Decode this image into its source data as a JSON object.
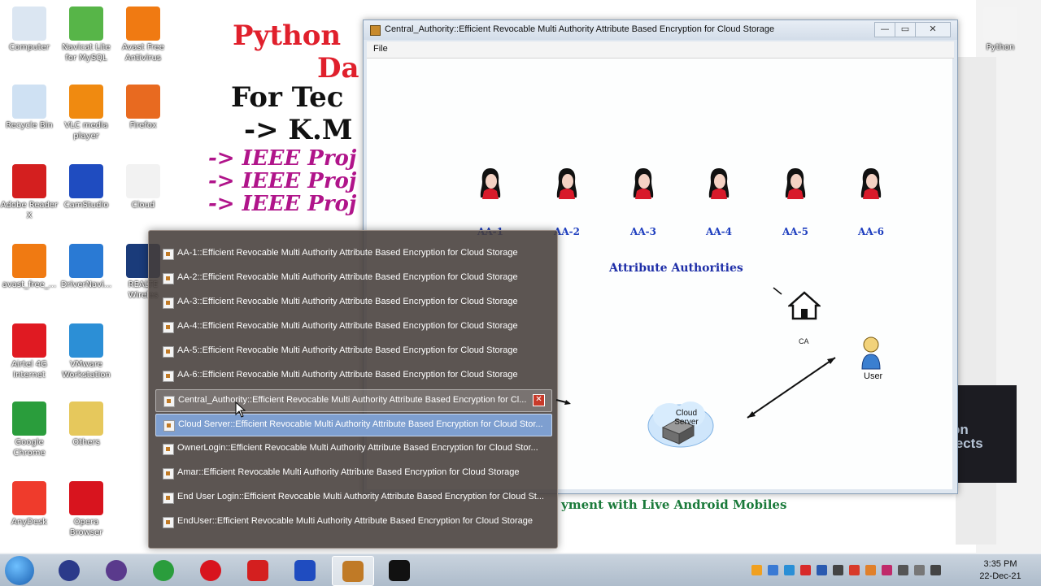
{
  "background_slide": {
    "title_line1": "Python",
    "title_line2": "Da",
    "title_line3": "For Tec",
    "title_line4": "-> K.M",
    "ieee_lines": [
      "-> IEEE Proj",
      "-> IEEE Proj",
      "-> IEEE Proj"
    ],
    "bottom_text": "yment with Live Android Mobiles",
    "dark_panel_text": "on\njects"
  },
  "desktop_icons": [
    {
      "label": "Computer",
      "icon": "computer-icon",
      "color": "#dbe6f2"
    },
    {
      "label": "Navicat Lite for MySQL",
      "icon": "navicat-icon",
      "color": "#57b548"
    },
    {
      "label": "Avast Free Antivirus",
      "icon": "avast-icon",
      "color": "#f07a12"
    },
    {
      "label": "Recycle Bin",
      "icon": "recycle-bin-icon",
      "color": "#cfe1f3"
    },
    {
      "label": "VLC media player",
      "icon": "vlc-icon",
      "color": "#f08a10"
    },
    {
      "label": "Firefox",
      "icon": "firefox-icon",
      "color": "#e86a20"
    },
    {
      "label": "Adobe Reader X",
      "icon": "adobe-reader-icon",
      "color": "#d41f1f"
    },
    {
      "label": "CamStudio",
      "icon": "camstudio-icon",
      "color": "#1f4cc0"
    },
    {
      "label": "Cloud",
      "icon": "cloud-folder-icon",
      "color": "#f2f2f2"
    },
    {
      "label": "avast_free_...",
      "icon": "avast-installer-icon",
      "color": "#f07a12"
    },
    {
      "label": "DriverNavi...",
      "icon": "drivernavigator-icon",
      "color": "#2a7ad4"
    },
    {
      "label": "REALTE Wireles",
      "icon": "realtek-icon",
      "color": "#1a3b7a"
    },
    {
      "label": "Airtel 4G Internet",
      "icon": "airtel-icon",
      "color": "#e01a22"
    },
    {
      "label": "VMware Workstation",
      "icon": "vmware-icon",
      "color": "#2c8fd6"
    },
    {
      "label": "Google Chrome",
      "icon": "chrome-icon",
      "color": "#2a9d3c"
    },
    {
      "label": "Others",
      "icon": "folder-icon",
      "color": "#e6c85c"
    },
    {
      "label": "AnyDesk",
      "icon": "anydesk-icon",
      "color": "#ef3b2c"
    },
    {
      "label": "Opera Browser",
      "icon": "opera-icon",
      "color": "#d8141e"
    },
    {
      "label": "Python",
      "icon": "python-file-icon",
      "color": "#f4f4f4"
    }
  ],
  "window": {
    "title": "Central_Authority::Efficient Revocable Multi Authority Attribute Based Encryption for Cloud Storage",
    "menu_file": "File",
    "btn_min": "—",
    "btn_max": "▭",
    "btn_close": "✕"
  },
  "diagram": {
    "authorities": [
      "AA-1",
      "AA-2",
      "AA-3",
      "AA-4",
      "AA-5",
      "AA-6"
    ],
    "group_label": "Attribute Authorities",
    "ca_label": "CA",
    "user_label": "User",
    "cloud_label": "Cloud Server"
  },
  "jump_list": {
    "items": [
      "AA-1::Efficient Revocable Multi Authority Attribute Based Encryption for Cloud Storage",
      "AA-2::Efficient Revocable Multi Authority Attribute Based Encryption for Cloud Storage",
      "AA-3::Efficient Revocable Multi Authority Attribute Based Encryption for Cloud Storage",
      "AA-4::Efficient Revocable Multi Authority Attribute Based Encryption for Cloud Storage",
      "AA-5::Efficient Revocable Multi Authority Attribute Based Encryption for Cloud Storage",
      "AA-6::Efficient Revocable Multi Authority Attribute Based Encryption for Cloud Storage",
      "Central_Authority::Efficient Revocable Multi Authority Attribute Based Encryption for Cl...",
      "Cloud Server::Efficient Revocable Multi Authority Attribute Based Encryption for Cloud Stor...",
      "OwnerLogin::Efficient Revocable Multi Authority Attribute Based Encryption for Cloud Stor...",
      "Amar::Efficient Revocable Multi Authority Attribute Based Encryption for Cloud Storage",
      "End User Login::Efficient Revocable Multi Authority Attribute Based Encryption for Cloud St...",
      "EndUser::Efficient Revocable Multi Authority Attribute Based Encryption for Cloud Storage"
    ],
    "close_glyph": "✕"
  },
  "taskbar": {
    "apps": [
      {
        "name": "eclipse-icon",
        "color": "#2b3a8a"
      },
      {
        "name": "eclipse-purple-icon",
        "color": "#5a3a8c"
      },
      {
        "name": "chrome-icon",
        "color": "#2a9d3c"
      },
      {
        "name": "opera-icon",
        "color": "#d8141e"
      },
      {
        "name": "adobe-reader-icon",
        "color": "#d41f1f"
      },
      {
        "name": "camstudio-icon",
        "color": "#1f4cc0"
      },
      {
        "name": "java-icon",
        "color": "#c07a26"
      },
      {
        "name": "command-prompt-icon",
        "color": "#111111"
      }
    ],
    "time": "3:35 PM",
    "date": "22-Dec-21"
  }
}
